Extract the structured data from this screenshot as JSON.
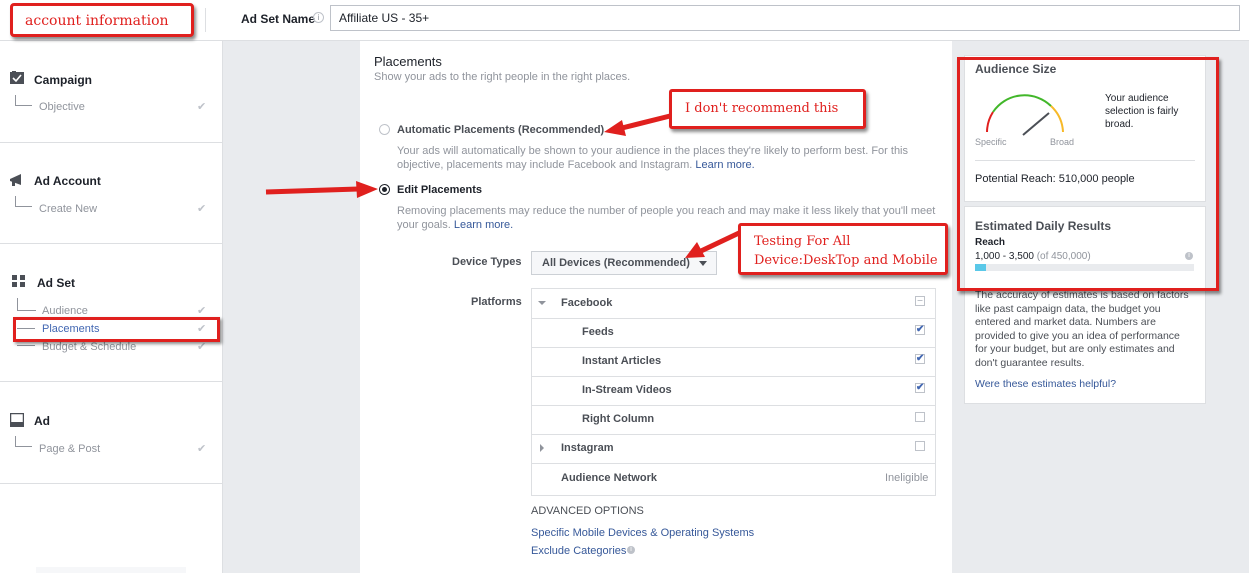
{
  "annotations": {
    "account_info": "account  information",
    "dont_recommend": "I don't recommend this",
    "testing_line1": "Testing For All",
    "testing_line2": "Device:DeskTop and Mobile"
  },
  "header": {
    "adset_name_label": "Ad Set Name",
    "adset_name_value": "Affiliate US - 35+"
  },
  "sidebar": {
    "campaign": {
      "title": "Campaign",
      "items": [
        "Objective"
      ]
    },
    "ad_account": {
      "title": "Ad Account",
      "items": [
        "Create New"
      ]
    },
    "ad_set": {
      "title": "Ad Set",
      "items": [
        "Audience",
        "Placements",
        "Budget & Schedule"
      ],
      "active": "Placements"
    },
    "ad": {
      "title": "Ad",
      "items": [
        "Page & Post"
      ]
    }
  },
  "placements": {
    "title": "Placements",
    "subtitle": "Show your ads to the right people in the right places.",
    "automatic": {
      "label": "Automatic Placements (Recommended)",
      "desc_line1": "Your ads will automatically be shown to your audience in the places they're likely to perform best. For this",
      "desc_line2": "objective, placements may include Facebook and Instagram.",
      "learn_more": "Learn more.",
      "selected": false
    },
    "edit": {
      "label": "Edit Placements",
      "desc_line1": "Removing placements may reduce the number of people you reach and may make it less likely that you'll meet",
      "desc_line2": "your goals.",
      "learn_more": "Learn more.",
      "selected": true
    },
    "device_types_label": "Device Types",
    "device_types_value": "All Devices (Recommended)",
    "platforms_label": "Platforms",
    "platforms": {
      "facebook": "Facebook",
      "feeds": "Feeds",
      "instant_articles": "Instant Articles",
      "instream_videos": "In-Stream Videos",
      "right_column": "Right Column",
      "instagram": "Instagram",
      "audience_network": "Audience Network",
      "audience_network_status": "Ineligible"
    },
    "advanced_options": "ADVANCED OPTIONS",
    "specific_devices_link": "Specific Mobile Devices & Operating Systems",
    "exclude_categories_link": "Exclude Categories"
  },
  "audience_size": {
    "title": "Audience Size",
    "gauge_specific": "Specific",
    "gauge_broad": "Broad",
    "desc_line1": "Your audience",
    "desc_line2": "selection is fairly",
    "desc_line3": "broad.",
    "potential_reach": "Potential Reach: 510,000 people"
  },
  "daily_results": {
    "title": "Estimated Daily Results",
    "reach_label": "Reach",
    "reach_value": "1,000 - 3,500",
    "reach_total": "(of 450,000)",
    "reach_fraction": 0.05,
    "accuracy_lines": [
      "The accuracy of estimates is based on factors",
      "like past campaign data, the budget you",
      "entered and market data. Numbers are",
      "provided to give you an idea of performance",
      "for your budget, but are only estimates and",
      "don't guarantee results."
    ],
    "helpful_link": "Were these estimates helpful?"
  },
  "colors": {
    "red": "#e0201e",
    "link": "#365899",
    "bar": "#5ac8e8"
  }
}
